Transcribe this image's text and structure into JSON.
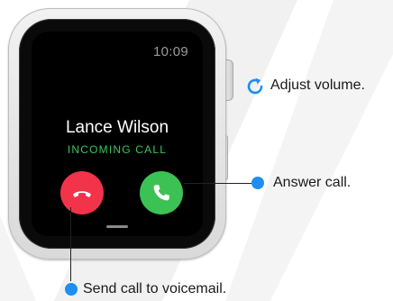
{
  "watch": {
    "time": "10:09",
    "caller_name": "Lance Wilson",
    "call_status": "INCOMING CALL",
    "decline_icon": "phone-hangup-icon",
    "answer_icon": "phone-icon"
  },
  "callouts": {
    "crown_label": "Adjust volume.",
    "answer_label": "Answer call.",
    "decline_label": "Send call to voicemail."
  },
  "colors": {
    "decline": "#f2334a",
    "answer": "#3cc254",
    "status": "#35c759",
    "callout_dot": "#1f8ef1"
  }
}
